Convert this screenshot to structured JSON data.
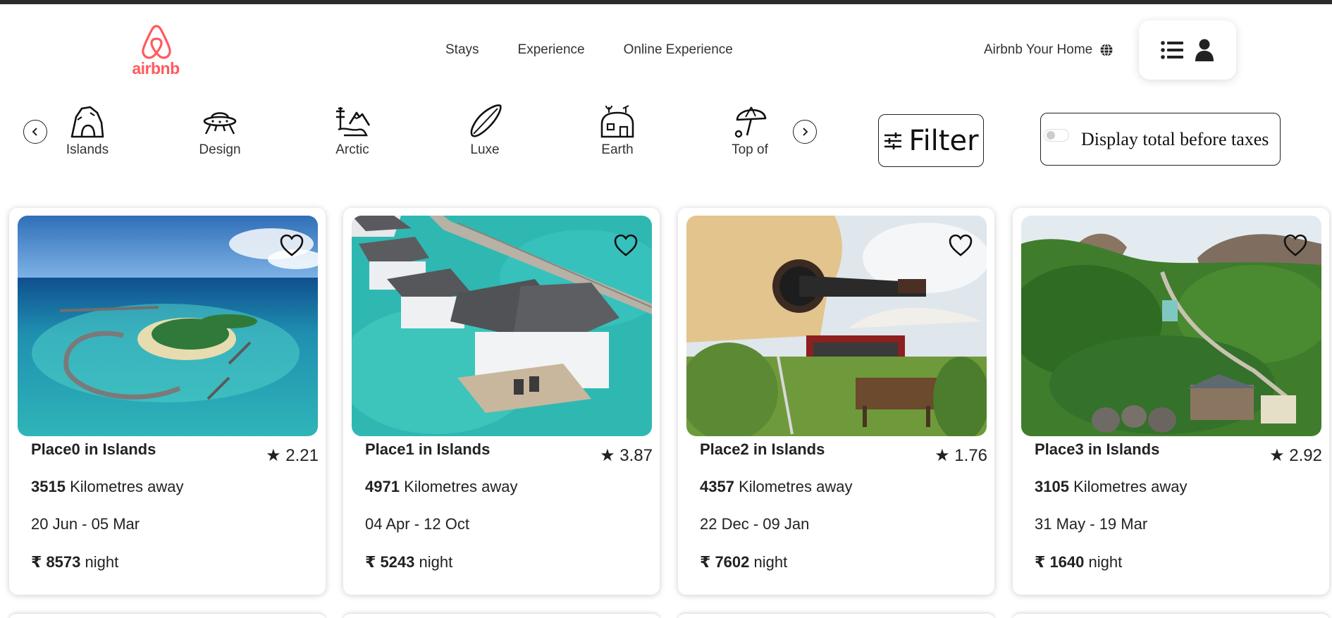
{
  "header": {
    "logo_text": "airbnb",
    "nav": [
      "Stays",
      "Experience",
      "Online Experience"
    ],
    "host_link": "Airbnb Your Home"
  },
  "categories": [
    {
      "label": "Islands",
      "icon": "islands-icon"
    },
    {
      "label": "Design",
      "icon": "design-ufo-icon"
    },
    {
      "label": "Arctic",
      "icon": "arctic-icon"
    },
    {
      "label": "Luxe",
      "icon": "luxe-surfboard-icon"
    },
    {
      "label": "Earth",
      "icon": "earth-home-icon"
    },
    {
      "label": "Top of",
      "icon": "top-of-umbrella-icon"
    }
  ],
  "filter": {
    "label": "Filter"
  },
  "tax_toggle": {
    "label": "Display total before taxes",
    "enabled": false
  },
  "listings": [
    {
      "title": "Place0 in Islands",
      "rating": "2.21",
      "distance": "3515",
      "distance_unit": "Kilometres away",
      "dates": "20 Jun - 05 Mar",
      "currency": "₹",
      "price": "8573",
      "price_unit": "night",
      "image": "island-atoll-photo"
    },
    {
      "title": "Place1 in Islands",
      "rating": "3.87",
      "distance": "4971",
      "distance_unit": "Kilometres away",
      "dates": "04 Apr - 12 Oct",
      "currency": "₹",
      "price": "5243",
      "price_unit": "night",
      "image": "water-villa-photo"
    },
    {
      "title": "Place2 in Islands",
      "rating": "1.76",
      "distance": "4357",
      "distance_unit": "Kilometres away",
      "dates": "22 Dec - 09 Jan",
      "currency": "₹",
      "price": "7602",
      "price_unit": "night",
      "image": "guitar-house-photo"
    },
    {
      "title": "Place3 in Islands",
      "rating": "2.92",
      "distance": "3105",
      "distance_unit": "Kilometres away",
      "dates": "31 May - 19 Mar",
      "currency": "₹",
      "price": "1640",
      "price_unit": "night",
      "image": "jungle-valley-photo"
    }
  ],
  "colors": {
    "brand": "#ff5a5f",
    "text": "#222222",
    "border": "#222222"
  }
}
